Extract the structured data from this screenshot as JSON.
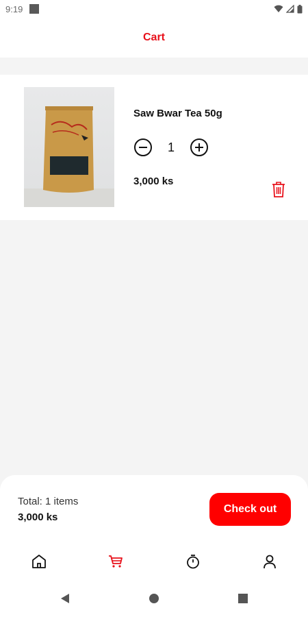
{
  "status_bar": {
    "time": "9:19"
  },
  "header": {
    "title": "Cart"
  },
  "cart": {
    "items": [
      {
        "name": "Saw Bwar Tea 50g",
        "quantity": "1",
        "price": "3,000 ks"
      }
    ]
  },
  "summary": {
    "total_items_label": "Total: 1 items",
    "total_amount": "3,000 ks",
    "checkout_label": "Check out"
  },
  "bottom_nav": {
    "items": [
      {
        "icon": "home-icon",
        "active": false
      },
      {
        "icon": "cart-icon",
        "active": true
      },
      {
        "icon": "timer-icon",
        "active": false
      },
      {
        "icon": "profile-icon",
        "active": false
      }
    ]
  },
  "colors": {
    "accent": "#e8101a",
    "button": "#ff0000",
    "background": "#f4f4f4"
  }
}
